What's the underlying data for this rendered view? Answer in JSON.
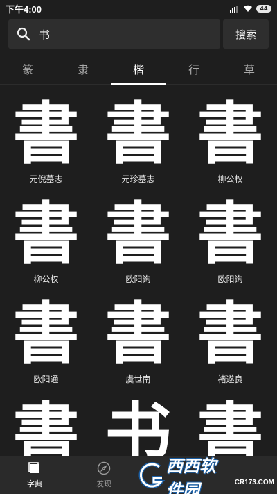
{
  "status_bar": {
    "time": "下午4:00",
    "battery": "44"
  },
  "search": {
    "value": "书",
    "button_label": "搜索"
  },
  "tabs": [
    {
      "label": "篆",
      "active": false
    },
    {
      "label": "隶",
      "active": false
    },
    {
      "label": "楷",
      "active": true
    },
    {
      "label": "行",
      "active": false
    },
    {
      "label": "草",
      "active": false
    }
  ],
  "grid": {
    "items": [
      {
        "glyph": "書",
        "caption": "元倪墓志"
      },
      {
        "glyph": "書",
        "caption": "元珍墓志"
      },
      {
        "glyph": "書",
        "caption": "柳公权"
      },
      {
        "glyph": "書",
        "caption": "柳公权"
      },
      {
        "glyph": "書",
        "caption": "欧阳询"
      },
      {
        "glyph": "書",
        "caption": "欧阳询"
      },
      {
        "glyph": "書",
        "caption": "欧阳通"
      },
      {
        "glyph": "書",
        "caption": "虞世南"
      },
      {
        "glyph": "書",
        "caption": "褚遂良"
      },
      {
        "glyph": "書",
        "caption": ""
      },
      {
        "glyph": "书",
        "caption": ""
      },
      {
        "glyph": "書",
        "caption": ""
      }
    ]
  },
  "bottom_nav": [
    {
      "label": "字典",
      "icon": "dictionary-icon",
      "active": true
    },
    {
      "label": "发现",
      "icon": "compass-icon",
      "active": false
    },
    {
      "label": "",
      "icon": "",
      "active": false
    },
    {
      "label": "",
      "icon": "",
      "active": false
    }
  ],
  "watermark": {
    "brand": "西西软件园",
    "site": "CR173.COM"
  },
  "colors": {
    "background": "#1e1e1e",
    "panel": "#2e2e2e",
    "accent": "#ffffff",
    "watermark_orange": "#f07d00",
    "watermark_blue": "#1b5fa5"
  }
}
